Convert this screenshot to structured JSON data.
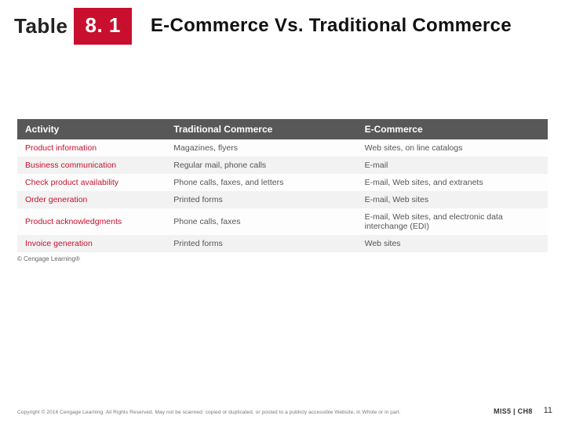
{
  "header": {
    "table_label": "Table",
    "number": "8. 1",
    "title": "E-Commerce Vs. Traditional Commerce"
  },
  "chart_data": {
    "type": "table",
    "title": "E-Commerce Vs. Traditional Commerce",
    "columns": [
      "Activity",
      "Traditional Commerce",
      "E-Commerce"
    ],
    "rows": [
      [
        "Product information",
        "Magazines, flyers",
        "Web sites, on line catalogs"
      ],
      [
        "Business communication",
        "Regular mail, phone calls",
        "E-mail"
      ],
      [
        "Check product availability",
        "Phone calls, faxes, and letters",
        "E-mail, Web sites, and extranets"
      ],
      [
        "Order generation",
        "Printed forms",
        "E-mail, Web sites"
      ],
      [
        "Product acknowledgments",
        "Phone calls, faxes",
        "E-mail, Web sites, and electronic data interchange (EDI)"
      ],
      [
        "Invoice generation",
        "Printed forms",
        "Web sites"
      ]
    ],
    "credit": "© Cengage Learning®"
  },
  "footer": {
    "copyright": "Copyright © 2016 Cengage Learning. All Rights Reserved. May not be scanned, copied or duplicated, or posted to a publicly accessible Website, in Whole or in part.",
    "book": "MIS5 | CH8",
    "page": "11"
  }
}
